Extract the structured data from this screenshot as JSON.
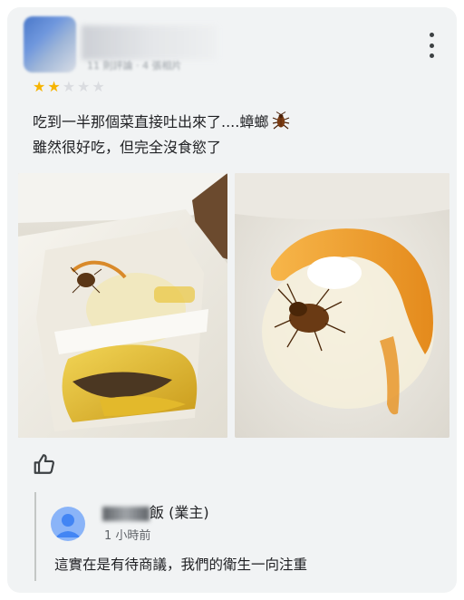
{
  "review": {
    "reviewer_meta": "11 則評論 · 4 張相片",
    "rating": 2,
    "rating_max": 5,
    "text_line1": "吃到一半那個菜直接吐出來了....蟑螂",
    "text_line2": "雖然很好吃，但完全沒食慾了",
    "emoji": "cockroach-emoji"
  },
  "owner_reply": {
    "name_suffix": "飯 (業主)",
    "time": "1 小時前",
    "text": "這實在是有待商議，我們的衛生一向注重"
  },
  "icons": {
    "menu": "more-vert-icon",
    "like": "thumb-up-icon",
    "star": "star-icon",
    "owner_avatar": "person-icon"
  },
  "colors": {
    "card_bg": "#f1f3f4",
    "star_on": "#f6b400",
    "star_off": "#dadce0",
    "owner_avatar": "#8ab4f8"
  }
}
